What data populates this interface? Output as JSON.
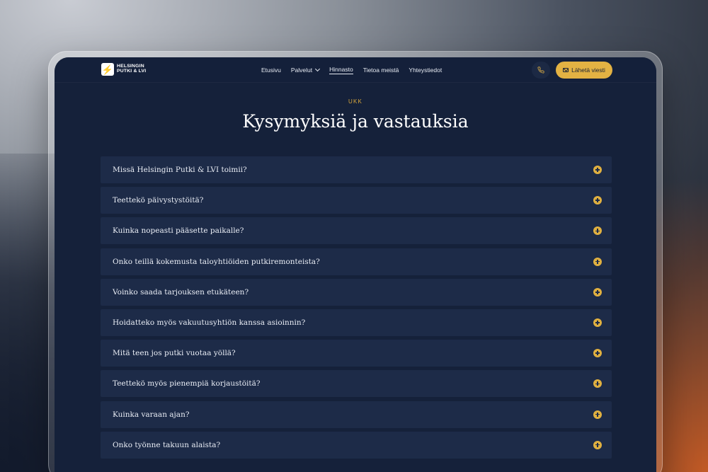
{
  "brand": {
    "logo_glyph": "⚡",
    "line1": "HELSINGIN",
    "line2": "PUTKI & LVI",
    "accent_color": "#e3b243"
  },
  "nav": {
    "items": [
      {
        "label": "Etusivu",
        "has_dropdown": false,
        "active": false
      },
      {
        "label": "Palvelut",
        "has_dropdown": true,
        "active": false
      },
      {
        "label": "Hinnasto",
        "has_dropdown": false,
        "active": true
      },
      {
        "label": "Tietoa meistä",
        "has_dropdown": false,
        "active": false
      },
      {
        "label": "Yhteystiedot",
        "has_dropdown": false,
        "active": false
      }
    ],
    "phone_icon": "phone-icon",
    "cta_label": "Lähetä viesti",
    "cta_icon": "mail-icon"
  },
  "section": {
    "eyebrow": "UKK",
    "title": "Kysymyksiä ja vastauksia"
  },
  "faq": [
    {
      "question": "Missä Helsingin Putki & LVI toimii?"
    },
    {
      "question": "Teettekö päivystystöitä?"
    },
    {
      "question": "Kuinka nopeasti pääsette paikalle?"
    },
    {
      "question": "Onko teillä kokemusta taloyhtiöiden putkiremonteista?"
    },
    {
      "question": "Voinko saada tarjouksen etukäteen?"
    },
    {
      "question": "Hoidatteko myös vakuutusyhtiön kanssa asioinnin?"
    },
    {
      "question": "Mitä teen jos putki vuotaa yöllä?"
    },
    {
      "question": "Teettekö myös pienempiä korjaustöitä?"
    },
    {
      "question": "Kuinka varaan ajan?"
    },
    {
      "question": "Onko työnne takuun alaista?"
    }
  ]
}
